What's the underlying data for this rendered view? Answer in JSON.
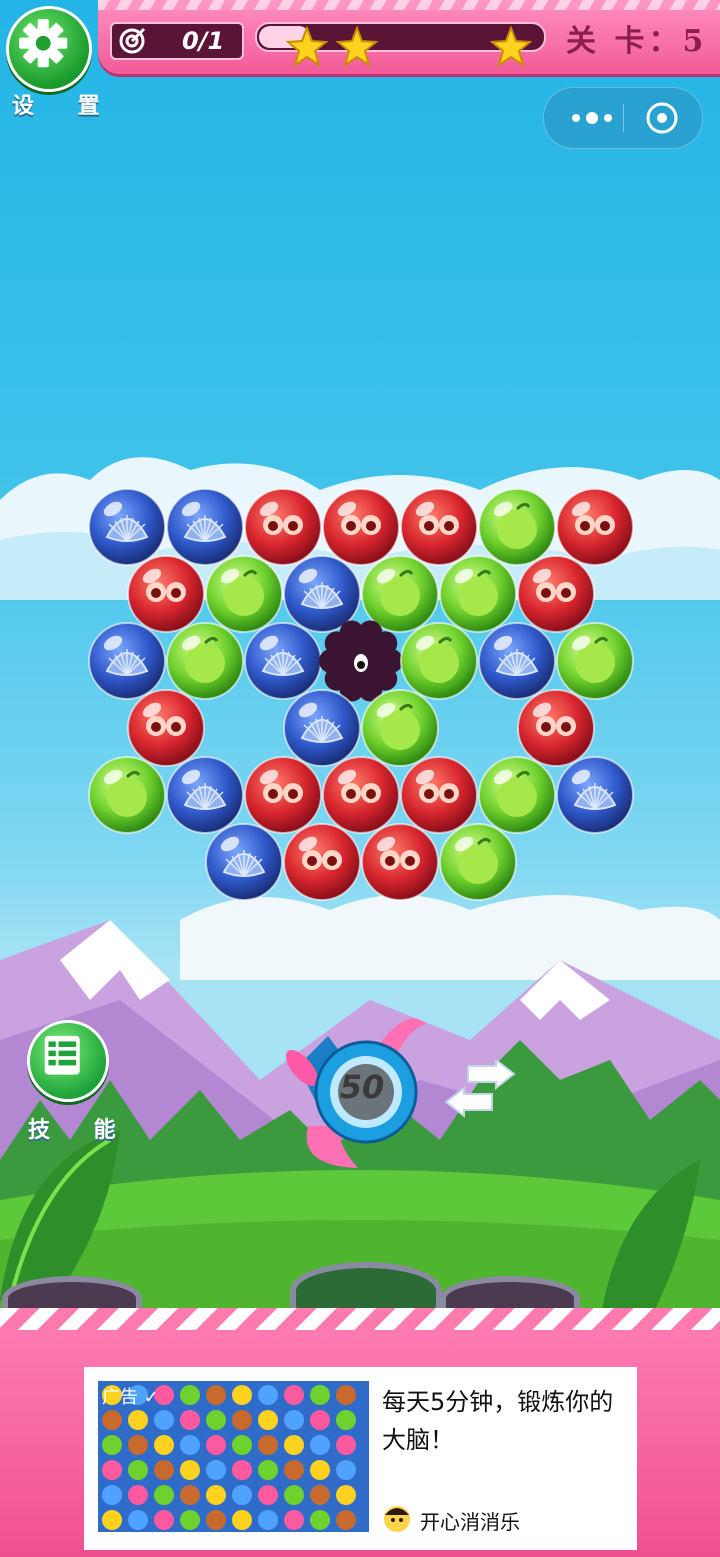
{
  "settings": {
    "label": "设 置",
    "icon": "gear-icon"
  },
  "topbar": {
    "target_text": "0/1",
    "target_icon": "target-icon",
    "progress": 0.18,
    "stars": 3,
    "level_label": "关 卡：5"
  },
  "capsule": {
    "more_icon": "more-dots-icon",
    "close_icon": "circle-close-icon"
  },
  "skill": {
    "label": "技 能",
    "icon": "list-icon"
  },
  "cannon": {
    "shots_left": "50",
    "swap_icon": "swap-arrows-icon"
  },
  "bubble_types": {
    "blue": {
      "name": "shell",
      "color": "#2f58c9"
    },
    "red": {
      "name": "eyes",
      "color": "#d8262e"
    },
    "green": {
      "name": "apple",
      "color": "#6fd12e"
    },
    "black": {
      "name": "blob",
      "color": "#3a1430"
    }
  },
  "bubble_rows": [
    [
      "blue",
      "blue",
      "red",
      "red",
      "red",
      "green",
      "red"
    ],
    [
      "red",
      "green",
      "blue",
      "green",
      "green",
      "red"
    ],
    [
      "blue",
      "green",
      "blue",
      "black",
      "green",
      "blue",
      "green"
    ],
    [
      "red",
      "",
      "blue",
      "green",
      "",
      "red"
    ],
    [
      "green",
      "blue",
      "red",
      "red",
      "red",
      "green",
      "blue"
    ],
    [
      "",
      "blue",
      "red",
      "red",
      "green",
      ""
    ]
  ],
  "ad": {
    "tag": "广告 ✓",
    "headline": "每天5分钟，锻炼你的大脑！",
    "brand": "开心消消乐"
  },
  "colors": {
    "accent": "#f25b98",
    "sky": "#23b4e6",
    "grass": "#5cc83a"
  }
}
